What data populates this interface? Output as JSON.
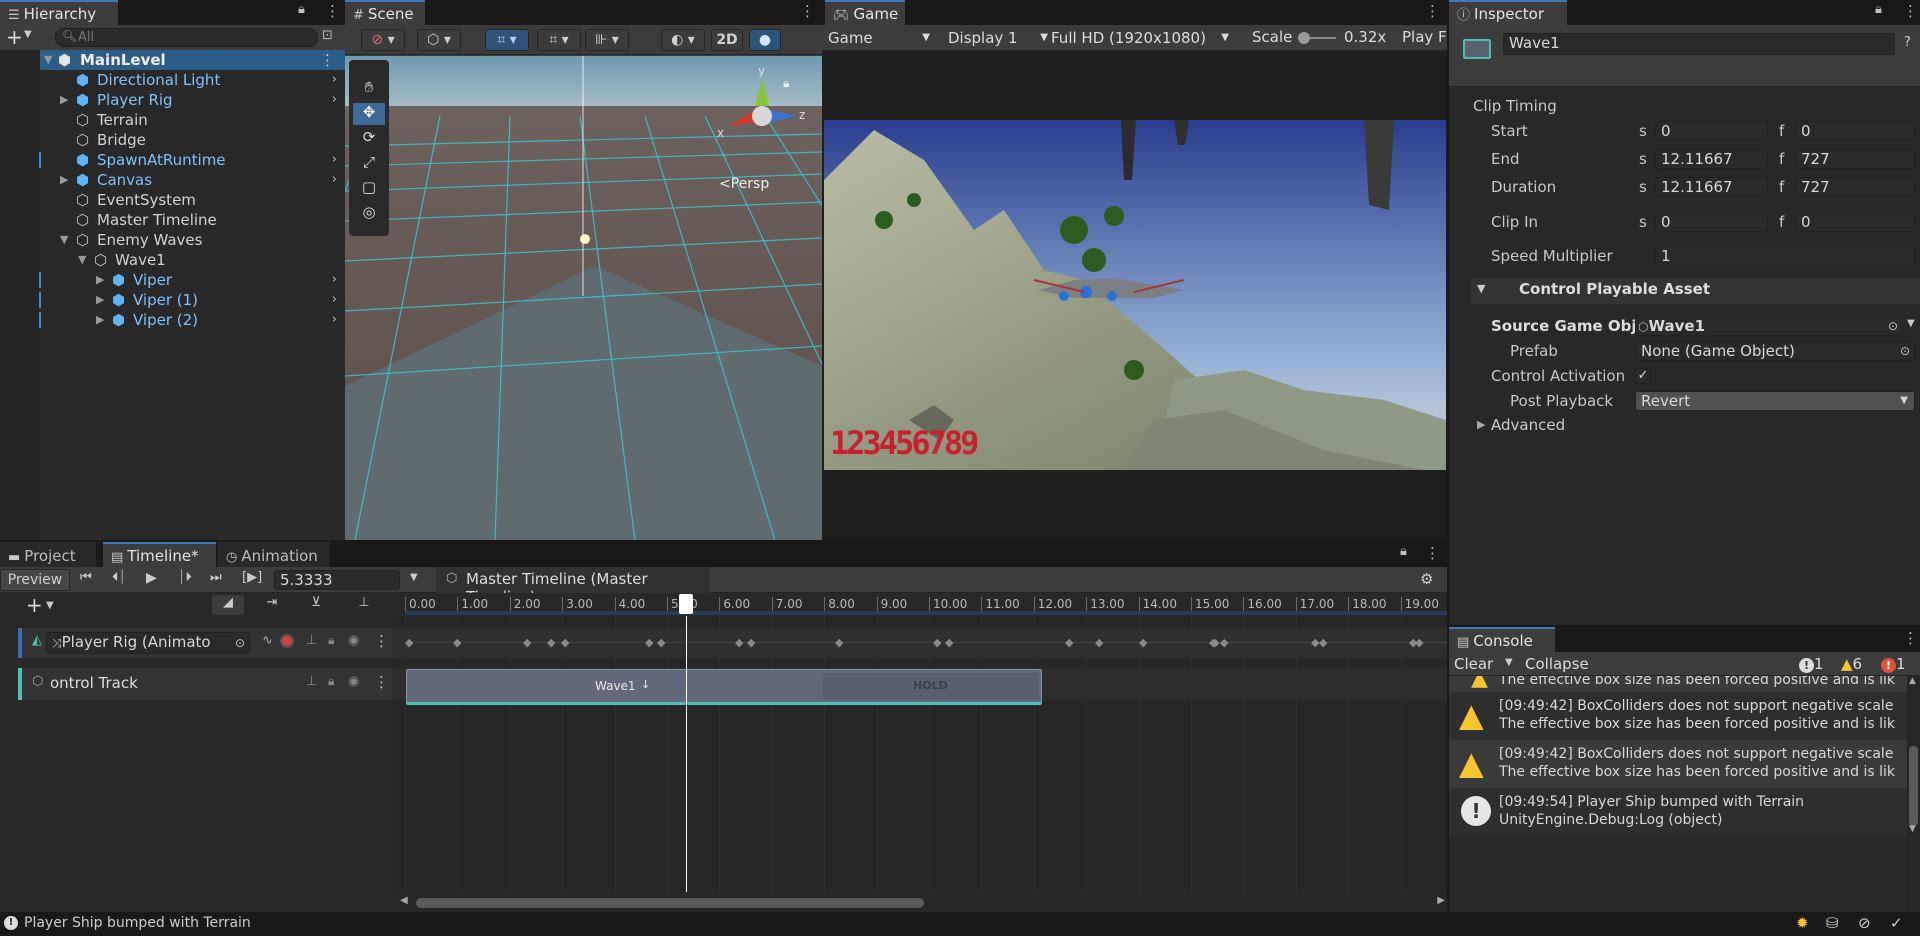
{
  "hierarchy": {
    "tab": "Hierarchy",
    "search_placeholder": "All",
    "scene": "MainLevel",
    "items": [
      {
        "label": "Directional Light"
      },
      {
        "label": "Player Rig"
      },
      {
        "label": "Terrain"
      },
      {
        "label": "Bridge"
      },
      {
        "label": "SpawnAtRuntime"
      },
      {
        "label": "Canvas"
      },
      {
        "label": "EventSystem"
      },
      {
        "label": "Master Timeline"
      },
      {
        "label": "Enemy Waves"
      },
      {
        "label": "Wave1"
      },
      {
        "label": "Viper"
      },
      {
        "label": "Viper (1)"
      },
      {
        "label": "Viper (2)"
      }
    ]
  },
  "scene": {
    "tab": "Scene",
    "mode_2d": "2D",
    "persp": "<Persp",
    "axis_x": "x",
    "axis_y": "y",
    "axis_z": "z"
  },
  "game": {
    "tab": "Game",
    "mode": "Game",
    "display": "Display 1",
    "resolution": "Full HD (1920x1080)",
    "scale_label": "Scale",
    "scale_value": "0.32x",
    "play_label": "Play F",
    "overlay_number": "123456789"
  },
  "inspector": {
    "tab": "Inspector",
    "object_name": "Wave1",
    "section_clip_timing": "Clip Timing",
    "rows": [
      {
        "label": "Start",
        "s": "0",
        "f": "0"
      },
      {
        "label": "End",
        "s": "12.11667",
        "f": "727"
      },
      {
        "label": "Duration",
        "s": "12.11667",
        "f": "727"
      },
      {
        "label": "Clip In",
        "s": "0",
        "f": "0"
      }
    ],
    "s_label": "s",
    "f_label": "f",
    "speed_label": "Speed Multiplier",
    "speed_value": "1",
    "section_control": "Control Playable Asset",
    "source_label": "Source Game Objec",
    "source_value": "Wave1",
    "prefab_label": "Prefab",
    "prefab_value": "None (Game Object)",
    "control_activation_label": "Control Activation",
    "post_playback_label": "Post Playback",
    "post_playback_value": "Revert",
    "advanced_label": "Advanced"
  },
  "bottom_tabs": {
    "project": "Project",
    "timeline": "Timeline*",
    "animation": "Animation"
  },
  "timeline": {
    "preview": "Preview",
    "time_value": "5.3333",
    "breadcrumb": "Master Timeline (Master Timeline)",
    "ticks": [
      "0.00",
      "1.00",
      "2.00",
      "3.00",
      "4.00",
      "5.00",
      "6.00",
      "7.00",
      "8.00",
      "9.00",
      "10.00",
      "11.00",
      "12.00",
      "13.00",
      "14.00",
      "15.00",
      "16.00",
      "17.00",
      "18.00",
      "19.00"
    ],
    "tracks": [
      {
        "label": "Player Rig (Animato"
      },
      {
        "label": "ontrol Track"
      }
    ],
    "clip_label": "Wave1",
    "hold_label": "HOLD"
  },
  "console": {
    "tab": "Console",
    "clear": "Clear",
    "collapse": "Collapse",
    "count_info": "1",
    "count_warn": "6",
    "count_error": "1",
    "partial_line": "The effective box size has been forced positive and is lik",
    "messages": [
      {
        "line1": "[09:49:42] BoxColliders does not support negative scale",
        "line2": "The effective box size has been forced positive and is lik"
      },
      {
        "line1": "[09:49:42] BoxColliders does not support negative scale",
        "line2": "The effective box size has been forced positive and is lik"
      },
      {
        "line1": "[09:49:54] Player Ship bumped with Terrain",
        "line2": "UnityEngine.Debug:Log (object)"
      }
    ]
  },
  "status_bar": {
    "message": "Player Ship bumped with Terrain"
  },
  "colors": {
    "accent": "#3a79bb",
    "selection": "#2c5d87",
    "prefab_blue": "#7ec1ff",
    "clip_teal": "#4bbfb1",
    "warning": "#f7c530"
  }
}
